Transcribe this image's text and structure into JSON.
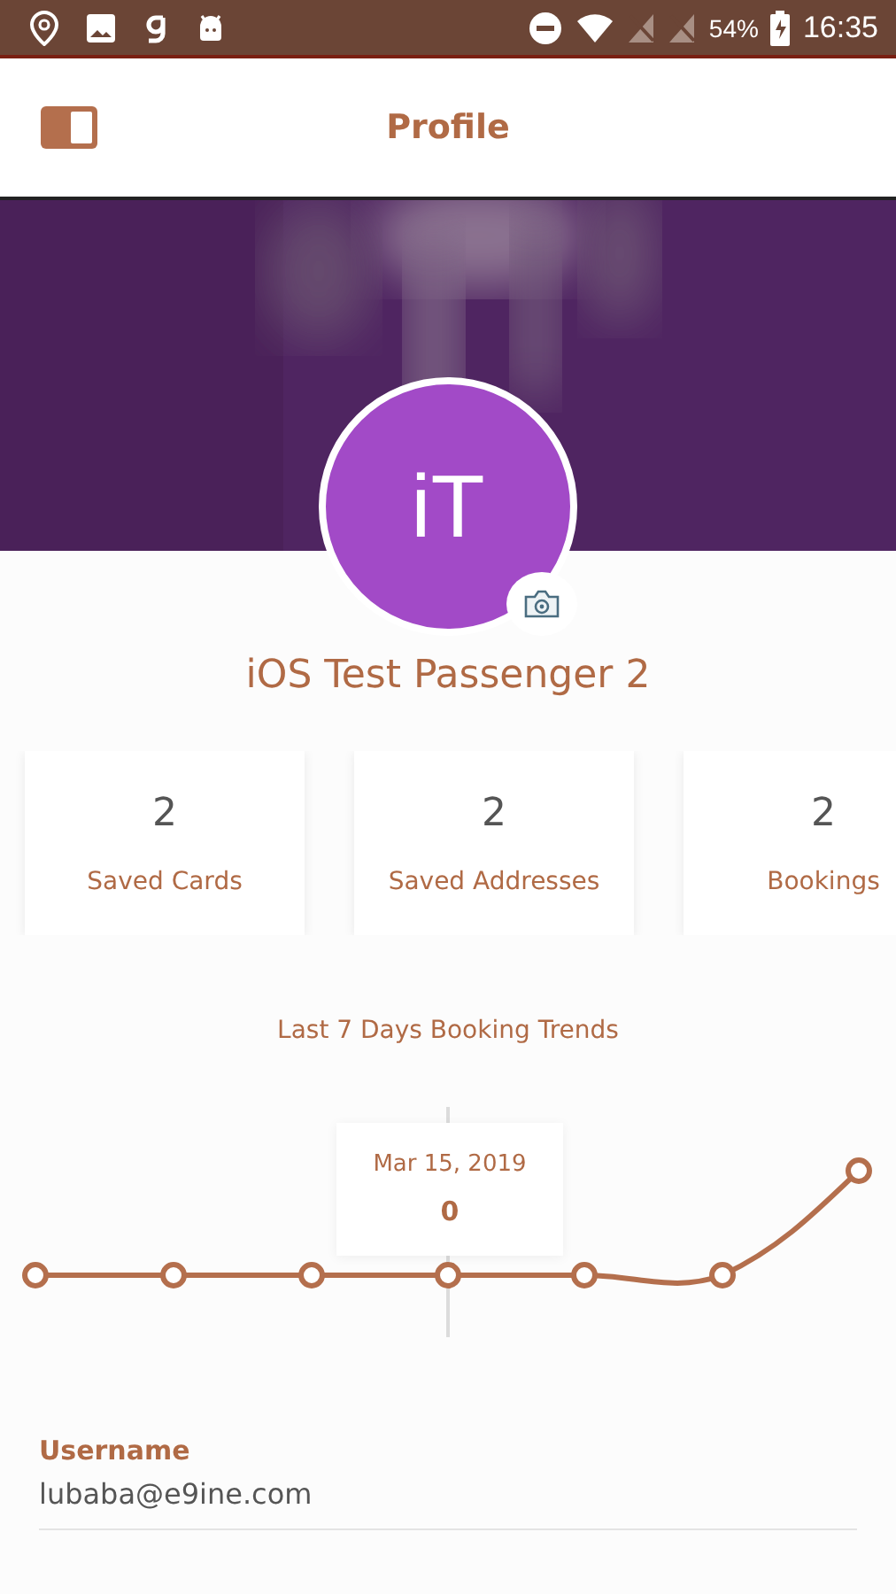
{
  "status_bar": {
    "battery": "54%",
    "time": "16:35"
  },
  "header": {
    "title": "Profile"
  },
  "profile": {
    "initials": "iT",
    "name": "iOS Test Passenger 2"
  },
  "stats": [
    {
      "count": "2",
      "label": "Saved Cards"
    },
    {
      "count": "2",
      "label": "Saved Addresses"
    },
    {
      "count": "2",
      "label": "Bookings"
    }
  ],
  "trends": {
    "title": "Last 7 Days Booking Trends",
    "tooltip": {
      "date": "Mar 15, 2019",
      "value": "0"
    }
  },
  "fields": [
    {
      "label": "Username",
      "value": "lubaba@e9ine.com"
    }
  ]
}
